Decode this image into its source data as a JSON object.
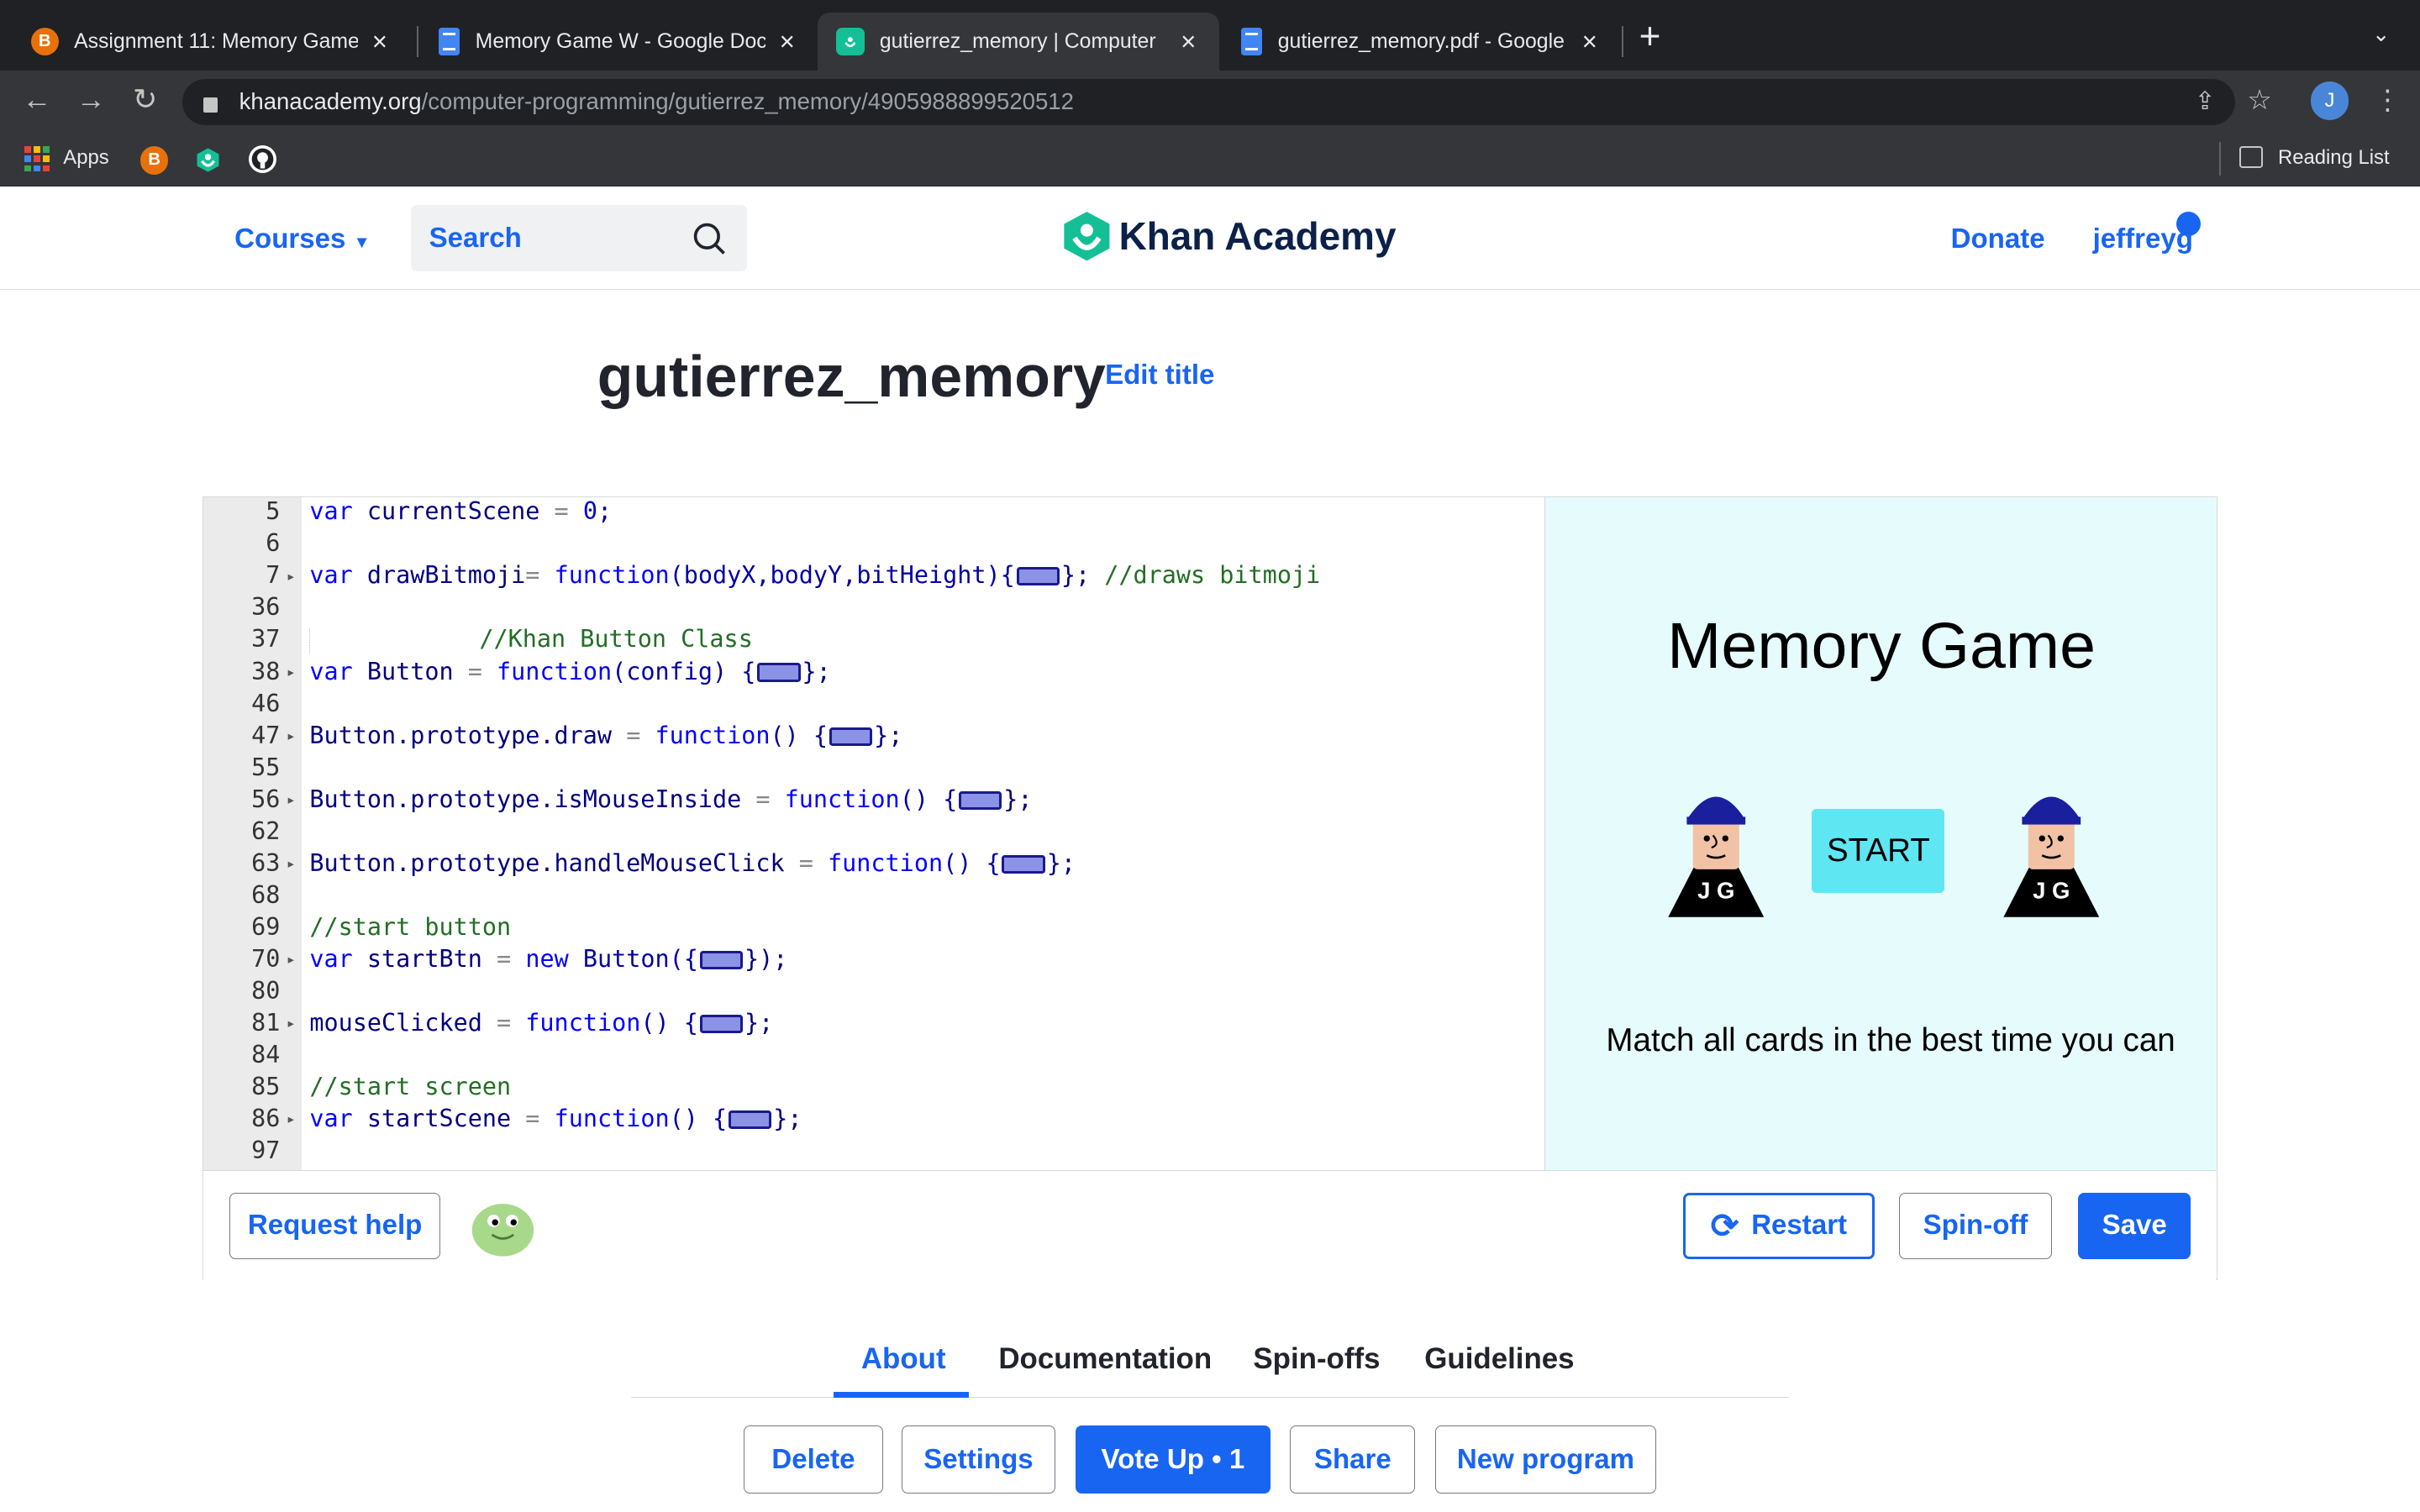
{
  "browser": {
    "tabs": [
      {
        "title": "Assignment 11: Memory Game",
        "icon": "brightspace-b-icon"
      },
      {
        "title": "Memory Game W - Google Doc",
        "icon": "google-docs-icon"
      },
      {
        "title": "gutierrez_memory | Computer",
        "icon": "khan-academy-icon",
        "active": true
      },
      {
        "title": "gutierrez_memory.pdf - Google",
        "icon": "google-docs-icon"
      }
    ],
    "url_host": "khanacademy.org",
    "url_path": "/computer-programming/gutierrez_memory/4905988899520512",
    "profile_initial": "J",
    "bookmarks": {
      "apps": "Apps",
      "reading_list": "Reading List"
    }
  },
  "header": {
    "courses": "Courses",
    "search_placeholder": "Search",
    "brand": "Khan Academy",
    "donate": "Donate",
    "user": "jeffreyg"
  },
  "program": {
    "title": "gutierrez_memory",
    "edit_title": "Edit title"
  },
  "code_lines": [
    {
      "n": "5",
      "fold": false
    },
    {
      "n": "6",
      "fold": false
    },
    {
      "n": "7",
      "fold": true
    },
    {
      "n": "36",
      "fold": false
    },
    {
      "n": "37",
      "fold": false
    },
    {
      "n": "38",
      "fold": true
    },
    {
      "n": "46",
      "fold": false
    },
    {
      "n": "47",
      "fold": true
    },
    {
      "n": "55",
      "fold": false
    },
    {
      "n": "56",
      "fold": true
    },
    {
      "n": "62",
      "fold": false
    },
    {
      "n": "63",
      "fold": true
    },
    {
      "n": "68",
      "fold": false
    },
    {
      "n": "69",
      "fold": false
    },
    {
      "n": "70",
      "fold": true
    },
    {
      "n": "80",
      "fold": false
    },
    {
      "n": "81",
      "fold": true
    },
    {
      "n": "84",
      "fold": false
    },
    {
      "n": "85",
      "fold": false
    },
    {
      "n": "86",
      "fold": true
    },
    {
      "n": "97",
      "fold": false
    }
  ],
  "code": {
    "l5": [
      "var",
      " currentScene ",
      "=",
      " ",
      "0",
      ";"
    ],
    "l7": [
      "var",
      " drawBitmoji",
      "=",
      " ",
      "function",
      "(bodyX,bodyY,bitHeight){",
      "}; ",
      "//draws bitmoji"
    ],
    "l37": "//Khan Button Class",
    "l38": [
      "var",
      " Button ",
      "=",
      " ",
      "function",
      "(config) {",
      "};"
    ],
    "l47": [
      "Button.prototype.draw ",
      "=",
      " ",
      "function",
      "() {",
      "};"
    ],
    "l56": [
      "Button.prototype.isMouseInside ",
      "=",
      " ",
      "function",
      "() {",
      "};"
    ],
    "l63": [
      "Button.prototype.handleMouseClick ",
      "=",
      " ",
      "function",
      "() {",
      "};"
    ],
    "l69": "//start button",
    "l70": [
      "var",
      " startBtn ",
      "=",
      " ",
      "new",
      " Button({",
      "});"
    ],
    "l81": [
      "mouseClicked ",
      "=",
      " ",
      "function",
      "() {",
      "};"
    ],
    "l85": "//start screen",
    "l86": [
      "var",
      " startScene ",
      "=",
      " ",
      "function",
      "() {",
      "};"
    ]
  },
  "canvas": {
    "title": "Memory Game",
    "start_label": "START",
    "badge_text": "J G",
    "subtitle": "Match all cards in the best time you can",
    "bg_color": "#e6fbfc",
    "start_color": "#5ee6f2"
  },
  "toolbar": {
    "request_help": "Request help",
    "restart": "Restart",
    "spinoff": "Spin-off",
    "save": "Save"
  },
  "info_tabs": [
    "About",
    "Documentation",
    "Spin-offs",
    "Guidelines"
  ],
  "actions": {
    "delete": "Delete",
    "settings": "Settings",
    "vote_up": "Vote Up • 1",
    "share": "Share",
    "new_program": "New program"
  },
  "colors": {
    "brand_blue": "#1865f2",
    "ka_green": "#14bf96"
  }
}
